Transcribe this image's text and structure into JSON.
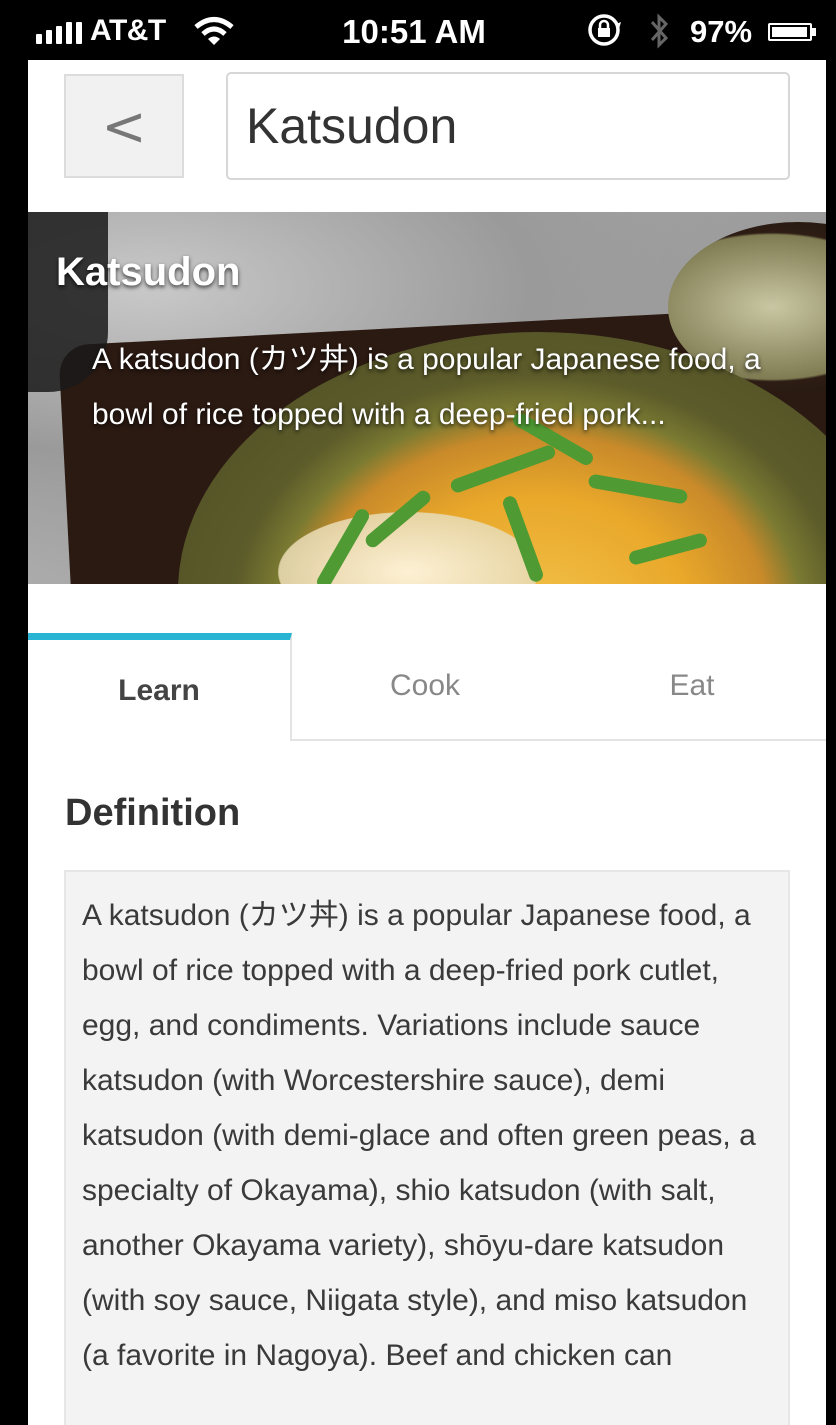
{
  "status_bar": {
    "carrier": "AT&T",
    "time": "10:51 AM",
    "battery_percent": "97%",
    "battery_level": 0.97,
    "icons": [
      "signal-icon",
      "wifi-icon",
      "rotation-lock-icon",
      "bluetooth-icon",
      "battery-icon"
    ]
  },
  "header": {
    "back_label": "<",
    "search_value": "Katsudon"
  },
  "hero": {
    "title": "Katsudon",
    "description": "A katsudon (カツ丼) is a popular Japanese food, a bowl of rice topped with a deep-fried pork..."
  },
  "tabs": [
    {
      "label": "Learn",
      "active": true
    },
    {
      "label": "Cook",
      "active": false
    },
    {
      "label": "Eat",
      "active": false
    }
  ],
  "definition": {
    "heading": "Definition",
    "text": "A katsudon (カツ丼) is a popular Japanese food, a bowl of rice topped with a deep-fried pork cutlet, egg, and condiments. Variations include sauce katsudon (with Worcestershire sauce), demi katsudon (with demi-glace and often green peas, a specialty of Okayama), shio katsudon (with salt, another Okayama variety), shōyu-dare katsudon (with soy sauce, Niigata style), and miso katsudon (a favorite in Nagoya). Beef and chicken can"
  },
  "colors": {
    "accent": "#2ab4d4",
    "status_bar_bg": "#000000"
  }
}
